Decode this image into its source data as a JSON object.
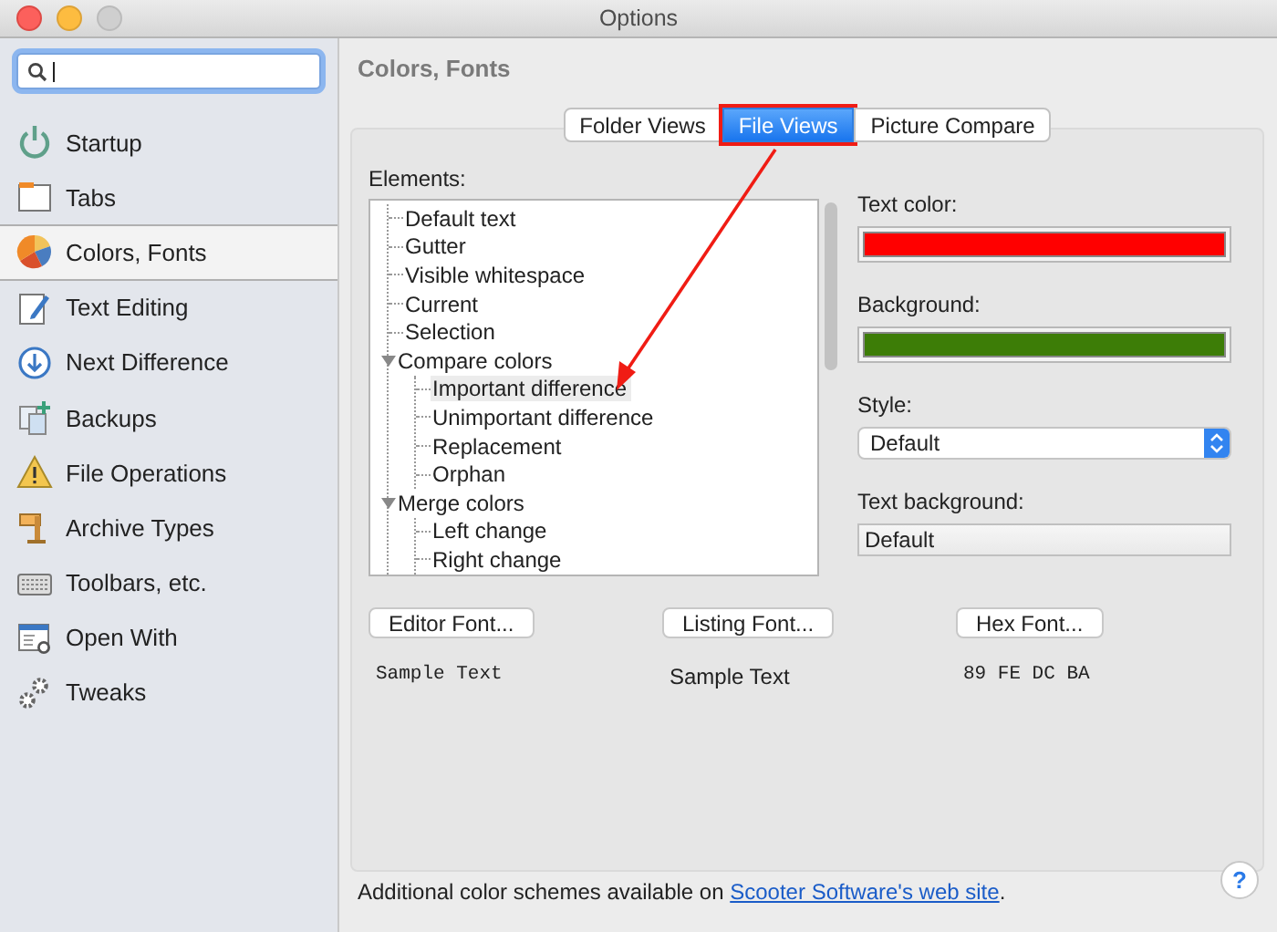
{
  "window": {
    "title": "Options"
  },
  "sidebar": {
    "search": {
      "focused": true
    },
    "items": [
      {
        "label": "Startup",
        "selected": false
      },
      {
        "label": "Tabs",
        "selected": false
      },
      {
        "label": "Colors, Fonts",
        "selected": true
      },
      {
        "label": "Text Editing",
        "selected": false
      },
      {
        "label": "Next Difference",
        "selected": false
      },
      {
        "label": "Backups",
        "selected": false
      },
      {
        "label": "File Operations",
        "selected": false
      },
      {
        "label": "Archive Types",
        "selected": false
      },
      {
        "label": "Toolbars, etc.",
        "selected": false
      },
      {
        "label": "Open With",
        "selected": false
      },
      {
        "label": "Tweaks",
        "selected": false
      }
    ]
  },
  "heading": "Colors, Fonts",
  "tabs": [
    {
      "label": "Folder Views",
      "selected": false,
      "highlighted": false
    },
    {
      "label": "File Views",
      "selected": true,
      "highlighted": true
    },
    {
      "label": "Picture Compare",
      "selected": false,
      "highlighted": false
    }
  ],
  "elements_label": "Elements:",
  "tree": [
    {
      "label": "Default text",
      "selected": false
    },
    {
      "label": "Gutter",
      "selected": false
    },
    {
      "label": "Visible whitespace",
      "selected": false
    },
    {
      "label": "Current",
      "selected": false
    },
    {
      "label": "Selection",
      "selected": false
    },
    {
      "label": "Compare colors",
      "selected": false,
      "expanded": true,
      "children": [
        {
          "label": "Important difference",
          "selected": true
        },
        {
          "label": "Unimportant difference",
          "selected": false
        },
        {
          "label": "Replacement",
          "selected": false
        },
        {
          "label": "Orphan",
          "selected": false
        }
      ]
    },
    {
      "label": "Merge colors",
      "selected": false,
      "expanded": true,
      "children": [
        {
          "label": "Left change",
          "selected": false
        },
        {
          "label": "Right change",
          "selected": false
        }
      ]
    }
  ],
  "text_color": {
    "label": "Text color:",
    "color": "#ff0000"
  },
  "background": {
    "label": "Background:",
    "color": "#3d7d07"
  },
  "style": {
    "label": "Style:",
    "value": "Default"
  },
  "text_background": {
    "label": "Text background:",
    "value": "Default"
  },
  "fonts": [
    {
      "button": "Editor Font...",
      "sample": "Sample Text",
      "kind": "mono"
    },
    {
      "button": "Listing Font...",
      "sample": "Sample Text",
      "kind": "sans"
    },
    {
      "button": "Hex Font...",
      "sample": "89 FE DC BA",
      "kind": "mono"
    }
  ],
  "footer": {
    "text": "Additional color schemes available on ",
    "link": "Scooter Software's web site",
    "after": "."
  },
  "help": "?"
}
